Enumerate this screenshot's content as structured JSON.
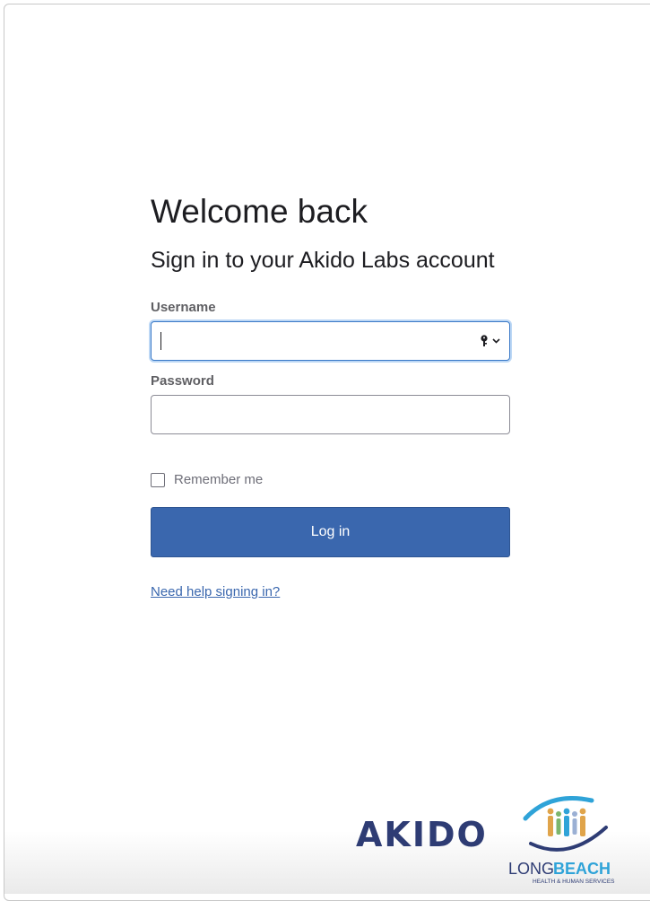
{
  "header": {
    "title": "Welcome back",
    "subtitle": "Sign in to your Akido Labs account"
  },
  "form": {
    "username_label": "Username",
    "username_value": "",
    "password_label": "Password",
    "password_value": "",
    "remember_label": "Remember me",
    "remember_checked": false,
    "login_label": "Log in",
    "help_link": "Need help signing in?"
  },
  "icons": {
    "password_manager": "key-icon",
    "dropdown": "chevron-down-icon"
  },
  "footer": {
    "akido_logo_text": "AKIDO",
    "lb_long": "LONG",
    "lb_beach": "BEACH",
    "lb_tagline": "HEALTH & HUMAN SERVICES"
  },
  "colors": {
    "primary": "#3a67ae",
    "focus": "#3a79c7",
    "akido_navy": "#2e3c74",
    "lb_blue": "#2fa3d8"
  }
}
